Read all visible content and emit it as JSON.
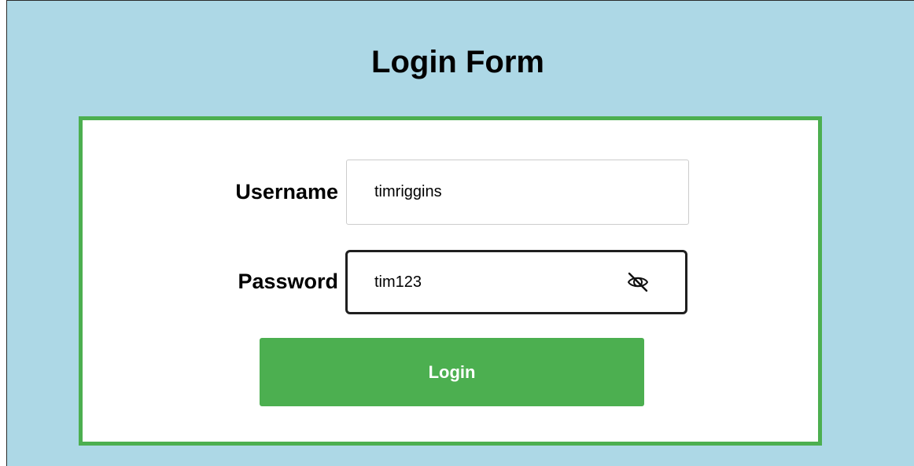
{
  "page": {
    "title": "Login Form"
  },
  "form": {
    "username_label": "Username",
    "username_value": "timriggins",
    "password_label": "Password",
    "password_value": "tim123",
    "password_toggle_icon": "eye-slash-icon",
    "login_label": "Login"
  },
  "colors": {
    "background": "#add8e6",
    "form_border": "#4caf50",
    "button": "#4caf50",
    "button_text": "#ffffff"
  }
}
